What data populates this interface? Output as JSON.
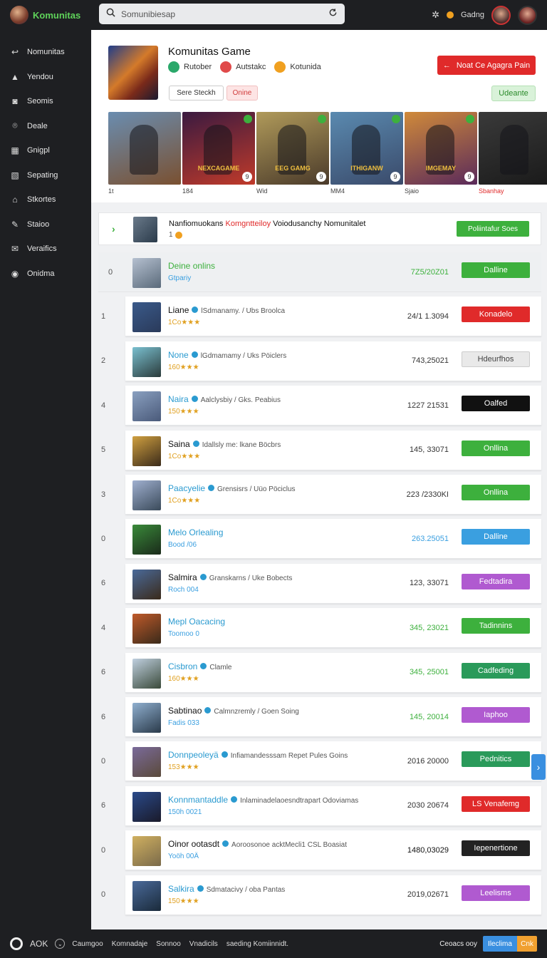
{
  "app": {
    "brand": "Komunitas"
  },
  "search": {
    "placeholder": "Somunibiesap"
  },
  "topbar": {
    "right_label": "Gadng"
  },
  "sidebar": {
    "items": [
      {
        "icon": "back-arrow-icon",
        "label": "Nomunitas",
        "glyph": "↩"
      },
      {
        "icon": "warning-icon",
        "label": "Yendou",
        "glyph": "▲"
      },
      {
        "icon": "camera-icon",
        "label": "Seomis",
        "glyph": "◙"
      },
      {
        "icon": "pin-icon",
        "label": "Deale",
        "glyph": "⌾"
      },
      {
        "icon": "grid-icon",
        "label": "Gnigpl",
        "glyph": "▦"
      },
      {
        "icon": "image-icon",
        "label": "Sepating",
        "glyph": "▧"
      },
      {
        "icon": "shop-icon",
        "label": "Stkortes",
        "glyph": "⌂"
      },
      {
        "icon": "tool-icon",
        "label": "Staioo",
        "glyph": "✎"
      },
      {
        "icon": "chat-icon",
        "label": "Veraifics",
        "glyph": "✉"
      },
      {
        "icon": "clock-icon",
        "label": "Onidma",
        "glyph": "◉"
      }
    ]
  },
  "game": {
    "title": "Komunitas Game",
    "tags": [
      {
        "label": "Rutober",
        "color": "#2aa86a"
      },
      {
        "label": "Autstakc",
        "color": "#e04a4a"
      },
      {
        "label": "Kotunida",
        "color": "#f0a020"
      }
    ],
    "add_button": "Noat Ce Agagra Pain",
    "pill_left": "Sere Steckh",
    "pill_right": "Onine",
    "update_button": "Udeante",
    "gallery": [
      {
        "caption": "1t",
        "banner": "",
        "colors": [
          "#6a8db0",
          "#7a5030"
        ]
      },
      {
        "caption": "184",
        "banner": "NEXCAGAME",
        "colors": [
          "#3a1a40",
          "#c03a2a"
        ]
      },
      {
        "caption": "Wid",
        "banner": "EEG GAMG",
        "colors": [
          "#b09a5a",
          "#4a3a2a"
        ]
      },
      {
        "caption": "MM4",
        "banner": "ITHIGANW",
        "colors": [
          "#5a8ab0",
          "#3a4a6a"
        ]
      },
      {
        "caption": "Sjaio",
        "banner": "IMGEMAY",
        "colors": [
          "#d08a3a",
          "#5a2a5a"
        ]
      },
      {
        "caption": "Sbanhay",
        "banner": "",
        "colors": [
          "#3a3a3a",
          "#1a1a1a"
        ]
      }
    ]
  },
  "featured": {
    "text_a": "Nanfiomuokans",
    "text_b": "Komgntteiloy",
    "text_c": "Voiodusanchy Nomunitalet",
    "sub": "1",
    "button": "Poliintafur Soes"
  },
  "rows": [
    {
      "idx": "0",
      "name": "Deine onlins",
      "name_color": "#3db03d",
      "sub": "Gtpariy",
      "date": "7Z5/20Z01",
      "date_color": "#3db03d",
      "status": "Dalline",
      "status_color": "#3db03d",
      "av": [
        "#b5c0d0",
        "#5a6a7a"
      ]
    },
    {
      "idx": "1",
      "name": "Liane",
      "name2": "lSdmanamy. / Ubs Broolca",
      "sub": "1Co★★★",
      "date": "24/1 1.3094",
      "date_color": "#333",
      "status": "Konadelo",
      "status_color": "#e02a2a",
      "av": [
        "#3a5a8a",
        "#2a3a5a"
      ]
    },
    {
      "idx": "2",
      "name": "None",
      "name2": "lGdmamamy / Uks Pöiclers",
      "sub": "160★★★",
      "date": "743,25021",
      "date_color": "#333",
      "status": "Hdeurfhos",
      "status_color": "#e9e9e9",
      "av": [
        "#7ac0d0",
        "#2a3a3a"
      ]
    },
    {
      "idx": "4",
      "name": "Naira",
      "name2": "Aalclysbiy / Gks. Peabius",
      "sub": "150★★★",
      "date": "1227 21531",
      "date_color": "#333",
      "status": "Oalfed",
      "status_color": "#111111",
      "av": [
        "#8aa0c0",
        "#4a5a7a"
      ]
    },
    {
      "idx": "5",
      "name": "Saina",
      "name2": "Idallsly me: lkane Böcbrs",
      "sub": "1Co★★★",
      "date": "145, 33071",
      "date_color": "#333",
      "status": "Onllina",
      "status_color": "#3db03d",
      "av": [
        "#d0a040",
        "#3a2a1a"
      ]
    },
    {
      "idx": "3",
      "name": "Paacyelie",
      "name2": "Grensisrs / Uüo Pöciclus",
      "sub": "1Co★★★",
      "date": "223 /2330KI",
      "date_color": "#333",
      "status": "Onllina",
      "status_color": "#3db03d",
      "av": [
        "#a0b0d0",
        "#3a4a5a"
      ]
    },
    {
      "idx": "0",
      "name": "Melo Orlealing",
      "sub": "Bood /06",
      "date": "263.25051",
      "date_color": "#3a9fe0",
      "status": "Dalline",
      "status_color": "#3a9fe0",
      "av": [
        "#3a8a3a",
        "#1a2a1a"
      ]
    },
    {
      "idx": "6",
      "name": "Salmira",
      "name2": "Granskarns / Uke Bobects",
      "sub": "Roch 004",
      "date": "123, 33071",
      "date_color": "#333",
      "status": "Fedtadira",
      "status_color": "#b05ad0",
      "av": [
        "#4a6a9a",
        "#3a2a1a"
      ]
    },
    {
      "idx": "4",
      "name": "Mepl Oacacing",
      "sub": "Toomoo 0",
      "date": "345, 23021",
      "date_color": "#3db03d",
      "status": "Tadinnins",
      "status_color": "#3db03d",
      "av": [
        "#c05a2a",
        "#3a2a1a"
      ]
    },
    {
      "idx": "6",
      "name": "Cisbron",
      "name2": "Clamle",
      "sub": "160★★★",
      "date": "345, 25001",
      "date_color": "#3db03d",
      "status": "Cadfeding",
      "status_color": "#2a9a5a",
      "av": [
        "#c0d0e0",
        "#3a4a3a"
      ]
    },
    {
      "idx": "6",
      "name": "Sabtinao",
      "name2": "Calmnzremly / Goen Soing",
      "sub": "Fadis 033",
      "date": "145, 20014",
      "date_color": "#3db03d",
      "status": "Iaphoo",
      "status_color": "#b05ad0",
      "av": [
        "#90b0d0",
        "#2a3a4a"
      ]
    },
    {
      "idx": "0",
      "name": "Donnpeoleyä",
      "name2": "Infiamandesssam Repet Pules Goins",
      "sub": "153★★★",
      "date": "2016 20000",
      "date_color": "#333",
      "status": "Pednitics",
      "status_color": "#2a9a5a",
      "av": [
        "#7a6a9a",
        "#5a4a3a"
      ]
    },
    {
      "idx": "6",
      "name": "Konnmantaddle",
      "name2": "Inlaminadelaoesndtrapart Odoviamas",
      "sub": "150h 0021",
      "date": "2030 20674",
      "date_color": "#333",
      "status": "LS Venafemg",
      "status_color": "#e02a2a",
      "av": [
        "#2a4a8a",
        "#1a1a2a"
      ]
    },
    {
      "idx": "0",
      "name": "Oinor ootasdt",
      "name2": "Aoroosonoe acktMecli1 CSL Boasiat",
      "sub": "Yoöh 00Ä",
      "date": "1480,03029",
      "date_color": "#111",
      "status": "Iepenertione",
      "status_color": "#222222",
      "av": [
        "#d0b060",
        "#7a6a4a"
      ]
    },
    {
      "idx": "0",
      "name": "Salkira",
      "name2": "Sdmatacivy / oba Pantas",
      "sub": "150★★★",
      "date": "2019,02671",
      "date_color": "#333",
      "status": "Leelisms",
      "status_color": "#b05ad0",
      "av": [
        "#4a6a9a",
        "#1a2a3a"
      ]
    }
  ],
  "bottombar": {
    "brand": "AOK",
    "items": [
      "Caumgoo",
      "Komnadaje",
      "Sonnoo",
      "Vnadicils",
      "saeding Komiinnidt."
    ],
    "right_label": "Ceoacs ooy",
    "btn_blue": "Ileclima",
    "btn_orange": "Cnk"
  }
}
